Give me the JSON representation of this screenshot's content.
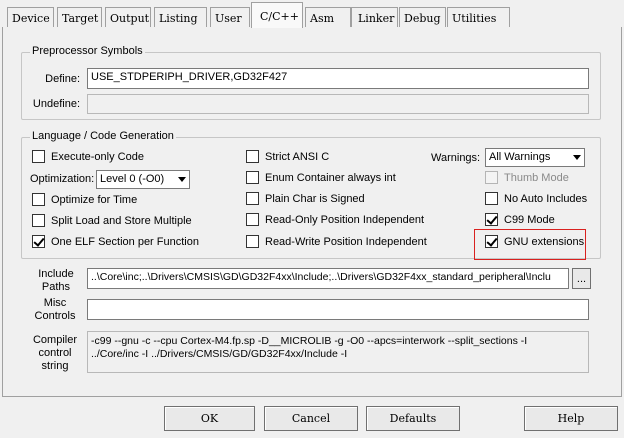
{
  "tabs": [
    {
      "label": "Device"
    },
    {
      "label": "Target"
    },
    {
      "label": "Output"
    },
    {
      "label": "Listing"
    },
    {
      "label": "User"
    },
    {
      "label": "C/C++"
    },
    {
      "label": "Asm"
    },
    {
      "label": "Linker"
    },
    {
      "label": "Debug"
    },
    {
      "label": "Utilities"
    }
  ],
  "preprocessor": {
    "title": "Preprocessor Symbols",
    "define_label": "Define:",
    "define_value": "USE_STDPERIPH_DRIVER,GD32F427",
    "undefine_label": "Undefine:",
    "undefine_value": ""
  },
  "language": {
    "title": "Language / Code Generation",
    "execute_only": "Execute-only Code",
    "optimization_label": "Optimization:",
    "optimization_value": "Level 0 (-O0)",
    "optimize_time": "Optimize for Time",
    "split_load": "Split Load and Store Multiple",
    "one_elf": "One ELF Section per Function",
    "strict_ansi": "Strict ANSI C",
    "enum_container": "Enum Container always int",
    "plain_char": "Plain Char is Signed",
    "ro_position": "Read-Only Position Independent",
    "rw_position": "Read-Write Position Independent",
    "warnings_label": "Warnings:",
    "warnings_value": "All Warnings",
    "thumb_mode": "Thumb Mode",
    "no_auto_includes": "No Auto Includes",
    "c99_mode": "C99 Mode",
    "gnu_extensions": "GNU extensions"
  },
  "include": {
    "label_line1": "Include",
    "label_line2": "Paths",
    "value": "..\\Core\\inc;..\\Drivers\\CMSIS\\GD\\GD32F4xx\\Include;..\\Drivers\\GD32F4xx_standard_peripheral\\Inclu",
    "browse": "..."
  },
  "misc": {
    "label_line1": "Misc",
    "label_line2": "Controls",
    "value": ""
  },
  "compiler": {
    "label_line1": "Compiler",
    "label_line2": "control",
    "label_line3": "string",
    "line1": "-c99 --gnu -c --cpu Cortex-M4.fp.sp -D__MICROLIB -g -O0 --apcs=interwork --split_sections -I",
    "line2": "../Core/inc -I ../Drivers/CMSIS/GD/GD32F4xx/Include -I"
  },
  "buttons": {
    "ok": "OK",
    "cancel": "Cancel",
    "defaults": "Defaults",
    "help": "Help"
  }
}
